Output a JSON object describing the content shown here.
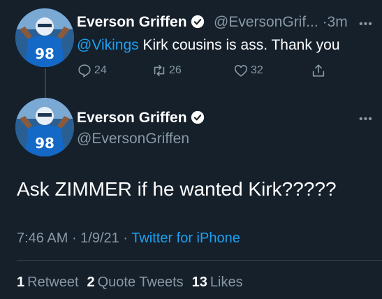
{
  "reply_tweet": {
    "name": "Everson Griffen",
    "handle": "@EversonGrif...",
    "separator": "·",
    "time": "3m",
    "mention": "@Vikings",
    "text": " Kirk cousins is ass. Thank you",
    "counts": {
      "replies": "24",
      "retweets": "26",
      "likes": "32"
    }
  },
  "main_tweet": {
    "name": "Everson Griffen",
    "handle": "@EversonGriffen",
    "text": "Ask ZIMMER if he wanted Kirk?????",
    "time": "7:46 AM",
    "sep1": " · ",
    "date": "1/9/21",
    "sep2": " · ",
    "source": "Twitter for iPhone",
    "stats": {
      "retweets_count": "1",
      "retweets_label": "Retweet",
      "quotes_count": "2",
      "quotes_label": "Quote Tweets",
      "likes_count": "13",
      "likes_label": "Likes"
    }
  },
  "more_glyph": "•••",
  "colors": {
    "background": "#15202b",
    "accent": "#1da1f2",
    "muted": "#8899a6",
    "divider": "#38444d"
  },
  "icons": [
    "verified-icon",
    "reply-icon",
    "retweet-icon",
    "like-icon",
    "share-icon",
    "more-icon"
  ]
}
